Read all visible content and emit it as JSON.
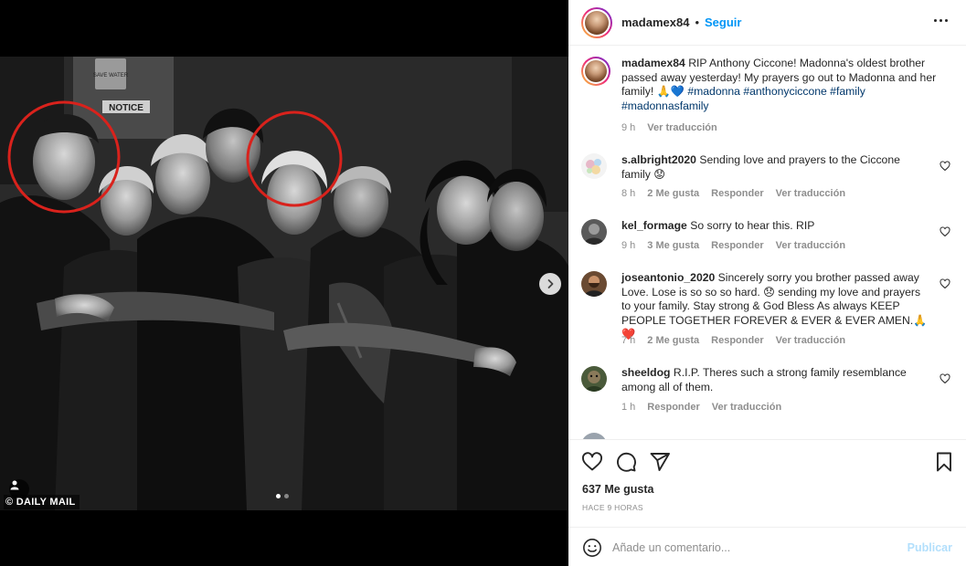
{
  "photo": {
    "watermark": "© DAILY MAIL",
    "sign_top": "SAVE WATER",
    "sign_notice": "NOTICE",
    "carousel_current": 1,
    "carousel_total": 2
  },
  "post": {
    "author": "madamex84",
    "separator": "•",
    "follow_label": "Seguir",
    "caption_text": "RIP Anthony Ciccone! Madonna's oldest brother passed away yesterday! My prayers go out to Madonna and her family! 🙏💙",
    "caption_tags": "#madonna #anthonyciccone #family #madonnasfamily",
    "caption_time": "9 h",
    "caption_translate": "Ver traducción"
  },
  "comments": [
    {
      "user": "s.albright2020",
      "text": "Sending love and prayers to the Ciccone family 😟",
      "time": "8 h",
      "likes": "2 Me gusta",
      "reply": "Responder",
      "translate": "Ver traducción"
    },
    {
      "user": "kel_formage",
      "text": "So sorry to hear this. RIP",
      "time": "9 h",
      "likes": "3 Me gusta",
      "reply": "Responder",
      "translate": "Ver traducción"
    },
    {
      "user": "joseantonio_2020",
      "text": "Sincerely sorry you brother passed away Love. Lose is so so so hard. 😞 sending my love and prayers to your family. Stay strong & God Bless As always KEEP PEOPLE TOGETHER FOREVER & EVER & EVER AMEN.🙏❤️",
      "time": "7 h",
      "likes": "2 Me gusta",
      "reply": "Responder",
      "translate": "Ver traducción"
    },
    {
      "user": "sheeldog",
      "text": "R.I.P. Theres such a strong family resemblance among all of them.",
      "time": "1 h",
      "reply": "Responder",
      "translate": "Ver traducción"
    }
  ],
  "engagement": {
    "likes": "637 Me gusta",
    "time": "HACE 9 HORAS"
  },
  "composer": {
    "placeholder": "Añade un comentario...",
    "publish_label": "Publicar"
  },
  "colors": {
    "accent": "#0095f6",
    "publish_disabled": "#b2dffc",
    "hashtag": "#00376b",
    "muted": "#8e8e8e",
    "highlight_circle": "#d9221c"
  },
  "icons": [
    "heart-icon",
    "comment-icon",
    "share-icon",
    "bookmark-icon",
    "emoji-icon",
    "more-options-icon",
    "chevron-right-icon",
    "user-tag-icon"
  ]
}
